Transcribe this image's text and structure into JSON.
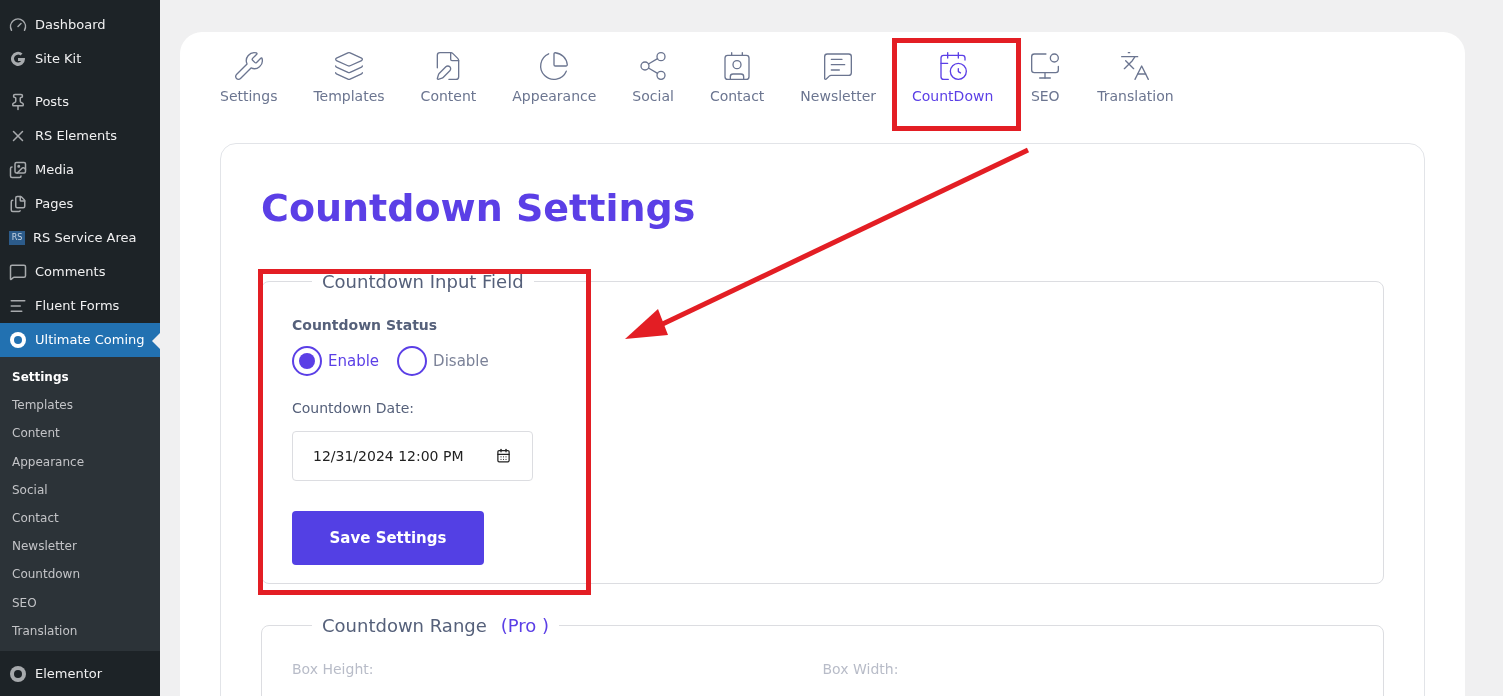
{
  "sidebar": {
    "items": [
      {
        "label": "Dashboard",
        "selected": false
      },
      {
        "label": "Site Kit",
        "selected": false
      },
      {
        "label": "Posts",
        "selected": false
      },
      {
        "label": "RS Elements",
        "selected": false
      },
      {
        "label": "Media",
        "selected": false
      },
      {
        "label": "Pages",
        "selected": false
      },
      {
        "label": "RS Service Area",
        "selected": false,
        "badge": "RS"
      },
      {
        "label": "Comments",
        "selected": false
      },
      {
        "label": "Fluent Forms",
        "selected": false
      },
      {
        "label": "Ultimate Coming",
        "selected": true,
        "children": [
          {
            "label": "Settings",
            "selected": true
          },
          {
            "label": "Templates",
            "selected": false
          },
          {
            "label": "Content",
            "selected": false
          },
          {
            "label": "Appearance",
            "selected": false
          },
          {
            "label": "Social",
            "selected": false
          },
          {
            "label": "Contact",
            "selected": false
          },
          {
            "label": "Newsletter",
            "selected": false
          },
          {
            "label": "Countdown",
            "selected": false
          },
          {
            "label": "SEO",
            "selected": false
          },
          {
            "label": "Translation",
            "selected": false
          }
        ]
      },
      {
        "label": "Elementor",
        "selected": false
      }
    ]
  },
  "tabs": [
    {
      "label": "Settings",
      "selected": false
    },
    {
      "label": "Templates",
      "selected": false
    },
    {
      "label": "Content",
      "selected": false
    },
    {
      "label": "Appearance",
      "selected": false
    },
    {
      "label": "Social",
      "selected": false
    },
    {
      "label": "Contact",
      "selected": false
    },
    {
      "label": "Newsletter",
      "selected": false
    },
    {
      "label": "CountDown",
      "selected": true
    },
    {
      "label": "SEO",
      "selected": false
    },
    {
      "label": "Translation",
      "selected": false
    }
  ],
  "page_title": "Countdown Settings",
  "input_section": {
    "legend": "Countdown Input Field",
    "status_label": "Countdown Status",
    "options": [
      {
        "label": "Enable",
        "selected": true
      },
      {
        "label": "Disable",
        "selected": false
      }
    ],
    "date_label": "Countdown Date:",
    "date_value": "12/31/2024 12:00 PM",
    "save_button": "Save Settings"
  },
  "range_section": {
    "legend": "Countdown Range",
    "badge": "(Pro )",
    "fields": [
      "Box Height:",
      "Box Width:"
    ]
  }
}
